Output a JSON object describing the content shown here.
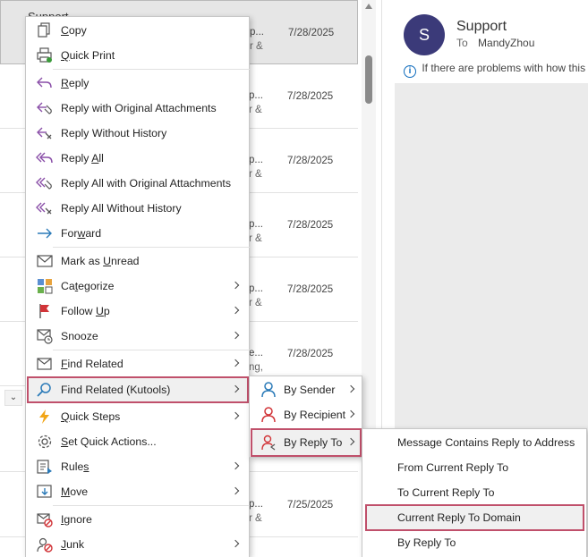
{
  "message_list": {
    "rows": [
      {
        "title": "Support",
        "snippet1": "p...",
        "snippet2": "r &",
        "date": "7/28/2025"
      },
      {
        "snippet1": "p...",
        "snippet2": "r &",
        "date": "7/28/2025"
      },
      {
        "snippet1": "p...",
        "snippet2": "r &",
        "date": "7/28/2025"
      },
      {
        "snippet1": "p...",
        "snippet2": "r &",
        "date": "7/28/2025"
      },
      {
        "snippet1": "p...",
        "snippet2": "r &",
        "date": "7/28/2025"
      },
      {
        "snippet1": "e...",
        "snippet2": "ng,",
        "date": "7/28/2025"
      },
      {
        "snippet1": "",
        "snippet2": "",
        "date": ""
      },
      {
        "snippet1": "p...",
        "snippet2": "r &",
        "date": "7/25/2025"
      }
    ]
  },
  "reading_pane": {
    "avatar_initial": "S",
    "sender": "Support",
    "to_label": "To",
    "to_value": "MandyZhou",
    "info_text": "If there are problems with how this m"
  },
  "context_menu": {
    "copy": {
      "pre": "",
      "u": "C",
      "post": "opy"
    },
    "quick_print": {
      "pre": "",
      "u": "Q",
      "post": "uick Print"
    },
    "reply": {
      "pre": "",
      "u": "R",
      "post": "eply"
    },
    "reply_orig": {
      "pre": "Reply with Original Attachments",
      "u": "",
      "post": ""
    },
    "reply_no_hist": {
      "pre": "Reply Without History",
      "u": "",
      "post": ""
    },
    "reply_all": {
      "pre": "Reply ",
      "u": "A",
      "post": "ll"
    },
    "reply_all_orig": {
      "pre": "Reply All with Original Attachments",
      "u": "",
      "post": ""
    },
    "reply_all_no_hist": {
      "pre": "Reply All Without History",
      "u": "",
      "post": ""
    },
    "forward": {
      "pre": "For",
      "u": "w",
      "post": "ard"
    },
    "mark_unread": {
      "pre": "Mark as ",
      "u": "U",
      "post": "nread"
    },
    "categorize": {
      "pre": "Ca",
      "u": "t",
      "post": "egorize"
    },
    "follow_up": {
      "pre": "Follow ",
      "u": "U",
      "post": "p"
    },
    "snooze": {
      "pre": "Snooze",
      "u": "",
      "post": ""
    },
    "find_related": {
      "pre": "",
      "u": "F",
      "post": "ind Related"
    },
    "find_related_kutools": {
      "pre": "Find Related (Kutools)",
      "u": "",
      "post": ""
    },
    "quick_steps": {
      "pre": "",
      "u": "Q",
      "post": "uick Steps"
    },
    "set_quick_actions": {
      "pre": "",
      "u": "S",
      "post": "et Quick Actions..."
    },
    "rules": {
      "pre": "Rule",
      "u": "s",
      "post": ""
    },
    "move": {
      "pre": "",
      "u": "M",
      "post": "ove"
    },
    "ignore": {
      "pre": "",
      "u": "I",
      "post": "gnore"
    },
    "junk": {
      "pre": "",
      "u": "J",
      "post": "unk"
    }
  },
  "submenu_kutools": {
    "by_sender": "By Sender",
    "by_recipient": "By Recipient",
    "by_reply_to": "By Reply To"
  },
  "submenu_reply_to": {
    "msg_contains": "Message Contains Reply to Address",
    "from_current": "From Current Reply To",
    "to_current": "To Current Reply To",
    "current_domain": "Current Reply To Domain",
    "by_reply_to": "By Reply To"
  },
  "colors": {
    "highlight_border": "#c0506b",
    "avatar": "#3b3a79",
    "accent": "#0f6cbd"
  }
}
